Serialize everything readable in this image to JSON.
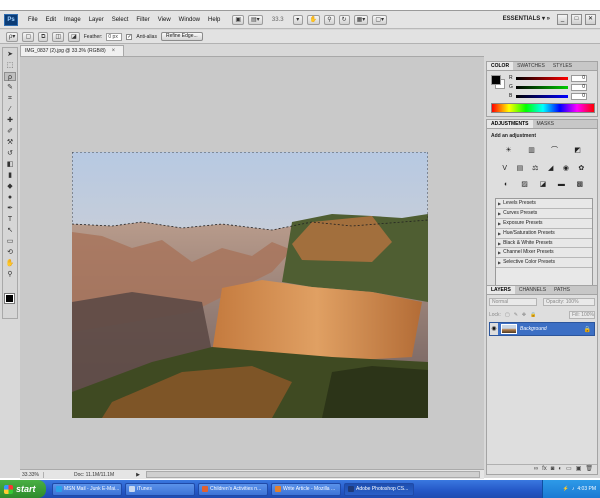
{
  "app": {
    "logo": "Ps",
    "menu": [
      "File",
      "Edit",
      "Image",
      "Layer",
      "Select",
      "Filter",
      "View",
      "Window",
      "Help"
    ],
    "zoom_display": "33.3",
    "workspace": "ESSENTIALS",
    "window_controls": [
      "_",
      "□",
      "✕"
    ]
  },
  "options": {
    "feather_label": "Feather:",
    "feather_value": "0 px",
    "antialias_label": "Anti-alias",
    "antialias_checked": true,
    "refine_button": "Refine Edge..."
  },
  "document": {
    "tab_title": "IMG_0837 (2).jpg @ 33.3% (RGB/8)",
    "zoom": "33.33%",
    "doc_size": "Doc: 11.1M/11.1M"
  },
  "color_panel": {
    "tabs": [
      "COLOR",
      "SWATCHES",
      "STYLES"
    ],
    "channels": [
      {
        "name": "R",
        "value": "0",
        "gradient": "#ff0000"
      },
      {
        "name": "G",
        "value": "0",
        "gradient": "#00cc00"
      },
      {
        "name": "B",
        "value": "0",
        "gradient": "#0000ff"
      }
    ]
  },
  "adjustments_panel": {
    "tabs": [
      "ADJUSTMENTS",
      "MASKS"
    ],
    "title": "Add an adjustment",
    "presets": [
      "Levels Presets",
      "Curves Presets",
      "Exposure Presets",
      "Hue/Saturation Presets",
      "Black & White Presets",
      "Channel Mixer Presets",
      "Selective Color Presets"
    ]
  },
  "layers_panel": {
    "tabs": [
      "LAYERS",
      "CHANNELS",
      "PATHS"
    ],
    "blend_mode": "Normal",
    "opacity": "Opacity: 100%",
    "lock_label": "Lock:",
    "fill": "Fill: 100%",
    "layers": [
      {
        "name": "Background",
        "visible": true,
        "locked": true
      }
    ]
  },
  "taskbar": {
    "start_label": "start",
    "tasks": [
      {
        "label": "MSN Mail - Junk E-Mai...",
        "color": "#2aa0e8",
        "active": false
      },
      {
        "label": "iTunes",
        "color": "#c8d8f0",
        "active": false
      },
      {
        "label": "Children's Activities n...",
        "color": "#e06030",
        "active": false
      },
      {
        "label": "Write Article - Mozilla ...",
        "color": "#e08030",
        "active": false
      },
      {
        "label": "Adobe Photoshop CS...",
        "color": "#1e3a7a",
        "active": true
      }
    ],
    "clock": "4:03 PM"
  }
}
